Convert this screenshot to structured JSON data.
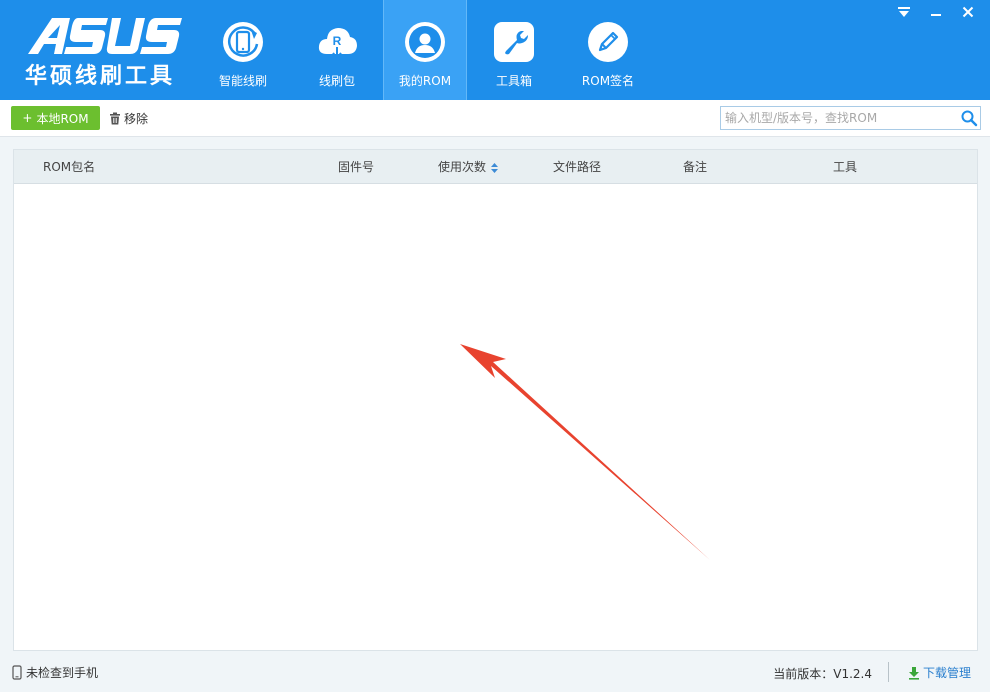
{
  "app": {
    "logo_text": "华硕线刷工具",
    "brand_color": "#1e8eea"
  },
  "nav": {
    "items": [
      {
        "label": "智能线刷",
        "icon": "phone-refresh-icon"
      },
      {
        "label": "线刷包",
        "icon": "cloud-download-icon"
      },
      {
        "label": "我的ROM",
        "icon": "user-icon"
      },
      {
        "label": "工具箱",
        "icon": "wrench-icon"
      },
      {
        "label": "ROM签名",
        "icon": "pencil-icon"
      }
    ],
    "active": "我的ROM"
  },
  "toolbar": {
    "add_local_label": "本地ROM",
    "add_prefix": "+",
    "remove_label": "移除",
    "search_placeholder": "输入机型/版本号，查找ROM"
  },
  "table": {
    "columns": [
      "ROM包名",
      "固件号",
      "使用次数",
      "文件路径",
      "备注",
      "工具"
    ],
    "rows": []
  },
  "annotation": {
    "arrow_color": "#e8432f"
  },
  "status": {
    "device_status": "未检查到手机",
    "version_label": "当前版本：",
    "version_value": "V1.2.4",
    "download_label": "下载管理"
  }
}
